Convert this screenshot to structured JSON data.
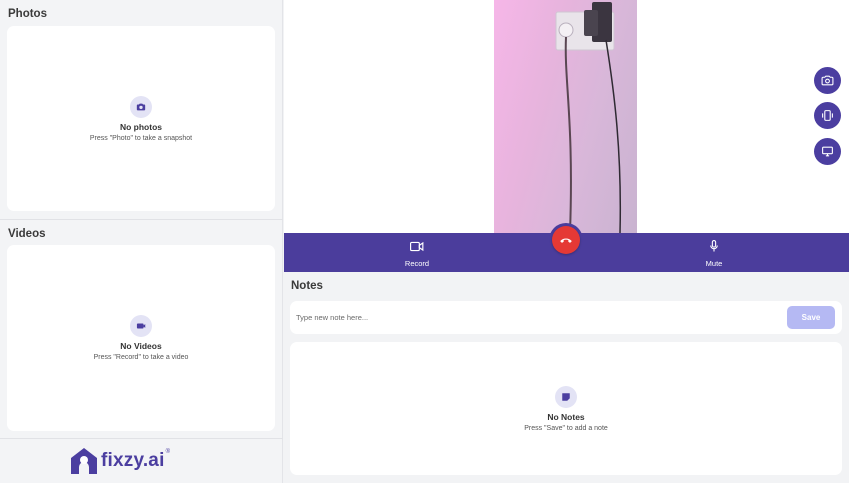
{
  "photos": {
    "title": "Photos",
    "empty_title": "No photos",
    "empty_sub": "Press \"Photo\" to take a snapshot"
  },
  "videos": {
    "title": "Videos",
    "empty_title": "No Videos",
    "empty_sub": "Press \"Record\" to take a video"
  },
  "brand": {
    "name": "fixzy.ai",
    "reg": "®",
    "color": "#4b3ea0"
  },
  "call_controls": {
    "record_label": "Record",
    "mute_label": "Mute"
  },
  "side_actions": [
    "camera-icon",
    "phone-rotate-icon",
    "monitor-icon"
  ],
  "notes": {
    "title": "Notes",
    "input_placeholder": "Type new note here...",
    "input_value": "",
    "save_label": "Save",
    "empty_title": "No Notes",
    "empty_sub": "Press \"Save\" to add a note"
  },
  "colors": {
    "accent": "#4b3d9c",
    "hangup": "#e53935",
    "save_disabled": "#b5b9f3"
  }
}
